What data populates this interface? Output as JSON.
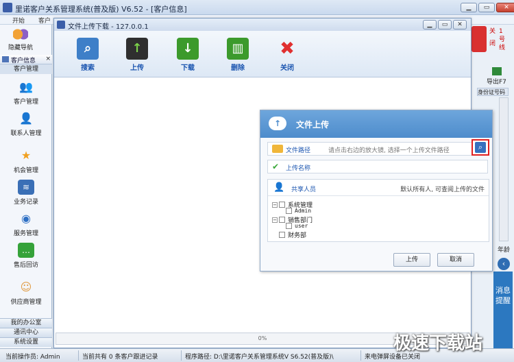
{
  "main_window": {
    "title": "里诺客户关系管理系统(普及版) V6.52 - [客户信息]",
    "menu": [
      "开始",
      "客户"
    ],
    "controls": {
      "minimize": "▁",
      "restore": "▭",
      "close": "✕"
    }
  },
  "left_nav": {
    "guide_label": "隐藏导航",
    "tab_label": "客户信息",
    "tab_close": "×",
    "section_header": "客户管理",
    "items": [
      {
        "label": "客户管理",
        "icon": "users-icon"
      },
      {
        "label": "联系人管理",
        "icon": "contact-icon"
      },
      {
        "label": "机会管理",
        "icon": "star-icon"
      },
      {
        "label": "业务记录",
        "icon": "chart-icon"
      },
      {
        "label": "服务管理",
        "icon": "globe-icon"
      },
      {
        "label": "售后回访",
        "icon": "chat-icon"
      },
      {
        "label": "供应商管理",
        "icon": "supplier-icon"
      }
    ],
    "bottom_items": [
      "我的办公室",
      "通讯中心",
      "系统设置"
    ]
  },
  "right_side": {
    "quit_chars": [
      "关",
      "闭",
      "1",
      "号",
      "线"
    ],
    "export_label": "导出F7",
    "column_header": "身份证号码",
    "year_label": "年龄",
    "collapse_icon": "‹",
    "message_panel": "消息提醒"
  },
  "file_dialog": {
    "title": "文件上传下载 - 127.0.0.1",
    "tools": [
      {
        "label": "搜索",
        "icon": "search-icon",
        "color": "#3e7fc8",
        "glyph": "⌕"
      },
      {
        "label": "上传",
        "icon": "upload-icon",
        "color": "#2f2f2f",
        "glyph": "↑"
      },
      {
        "label": "下载",
        "icon": "download-icon",
        "color": "#3c9a2c",
        "glyph": "↓"
      },
      {
        "label": "删除",
        "icon": "trash-icon",
        "color": "#3c9a2c",
        "glyph": "▥"
      },
      {
        "label": "关闭",
        "icon": "close-icon",
        "color": "#ffffff",
        "glyph": "✖"
      }
    ],
    "progress": "0%"
  },
  "upload_dialog": {
    "title": "文件上传",
    "path_label": "文件路径",
    "path_placeholder": "请点击右边的放大镜, 选择一个上传文件路径",
    "name_label": "上传名称",
    "share_label": "共享人员",
    "share_hint": "默认所有人, 可查阅上传的文件",
    "tree": [
      {
        "label": "系统管理",
        "level": 0,
        "expand": "−"
      },
      {
        "label": "Admin",
        "level": 1,
        "mono": true
      },
      {
        "label": "销售部门",
        "level": 0,
        "expand": "−"
      },
      {
        "label": "user",
        "level": 1,
        "mono": true
      },
      {
        "label": "财务部",
        "level": 0,
        "expand": ""
      }
    ],
    "upload_button": "上传",
    "cancel_button": "取消"
  },
  "status_bar": {
    "operator": "当前操作员: Admin",
    "records": "当前共有 0 条客户跟进记录",
    "path": "程序路径: D:\\里诺客户关系管理系统V S6.52(普及版)\\",
    "device": "来电弹屏设备已关闭"
  },
  "watermark": "极速下载站"
}
